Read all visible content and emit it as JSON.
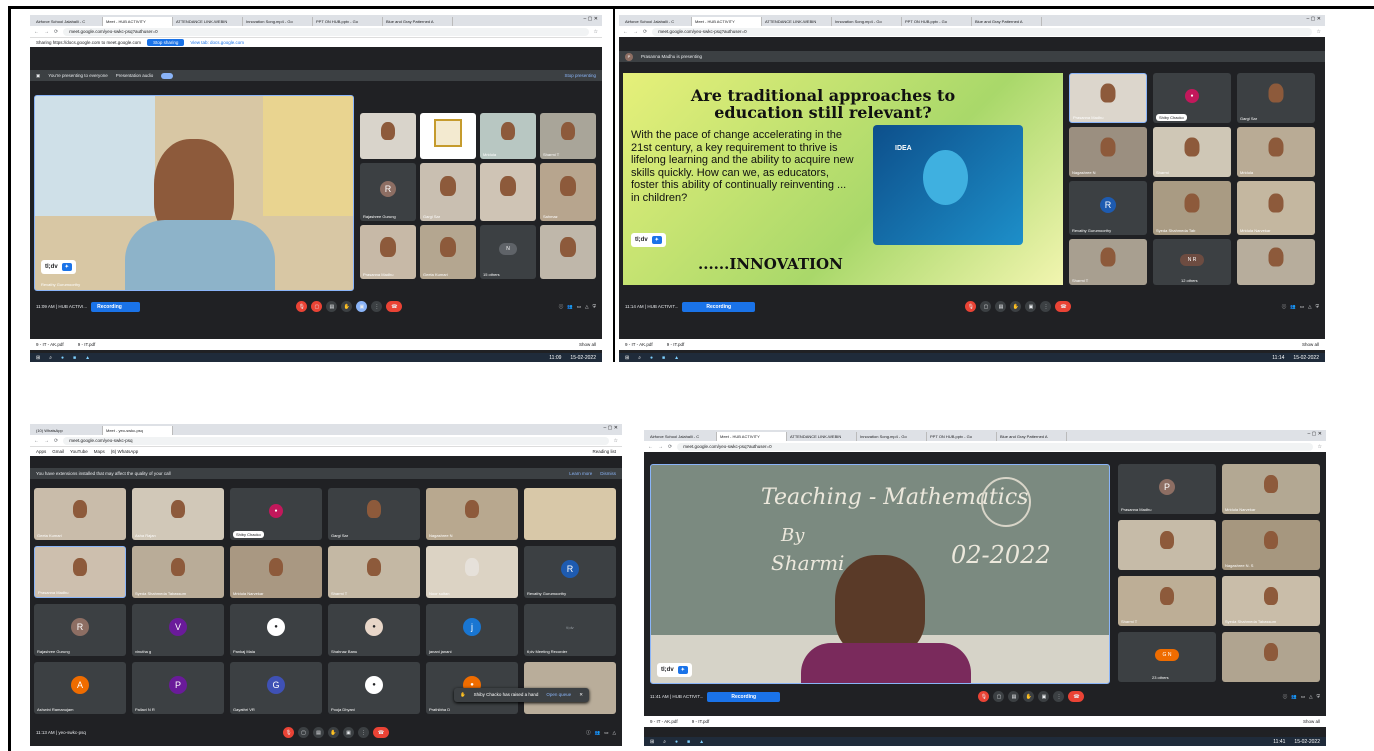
{
  "browser": {
    "tabs_a": [
      "Airforce School Jalahalli - C",
      "Meet - HUB ACTIVITY",
      "ATTENDANCE LINK-WEBIN",
      "Innovation Song.mp4 - Go",
      "PPT ON HUB.pptx - Go",
      "Blue and Gray Patterned A"
    ],
    "tabs_c": [
      "(10) WhatsApp",
      "Meet - yeo-swkc-psq"
    ],
    "url_a": "meet.google.com/yeo-swkc-psq?authuser=0",
    "url_c": "meet.google.com/yeo-swkc-psq",
    "bookmarks_c": [
      "Apps",
      "Gmail",
      "YouTube",
      "Maps",
      "(6) WhatsApp"
    ],
    "reading_list": "Reading list"
  },
  "panel1": {
    "sharing_text": "Sharing https://docs.google.com to meet.google.com",
    "stop_sharing": "Stop sharing",
    "view_tab": "View tab: docs.google.com",
    "presenting": "You're presenting to everyone",
    "presentation_audio": "Presentation audio",
    "stop_presenting": "Stop presenting",
    "main_name": "Revathy Gurumoorthy",
    "tiles": [
      "",
      "",
      "Mridula",
      "Sharmi T",
      "Rajashree Gurung",
      "Gargi Sar",
      "",
      "Sahmaz",
      "Prasanna Madhu",
      "Geeta Kumari",
      "15 others",
      ""
    ],
    "avatar_letter": "R",
    "time_meeting": "11:09 AM | HUB ACTIVI...",
    "recording": "Recording",
    "downloads": [
      "9 - IT - AK.pdf",
      "9 - IT.pdf"
    ],
    "show_all": "Show all",
    "clock_time": "11:09",
    "clock_date": "15-02-2022"
  },
  "panel2": {
    "presenting": "Prasanna Madhu is presenting",
    "slide_title": "Are traditional approaches to education still relevant?",
    "slide_body": "With the pace of change accelerating in the 21st century, a key requirement to thrive is lifelong learning and the ability to acquire new skills quickly. How can we, as educators, foster this ability of continually reinventing ... in children?",
    "slide_footer": "......INNOVATION",
    "tiles": [
      "Prasanna Madhu",
      "Shiby Chacko",
      "Gargi Sar",
      "Nagashree N",
      "Sharmi",
      "Mridula",
      "Revathy Gurumoorthy",
      "Syeda Shahmeda Tab",
      "Mridula Narvekar",
      "Sharmi T",
      "12 others",
      ""
    ],
    "avatar_letter": "R",
    "time_meeting": "11:14 AM | HUB ACTIVIT...",
    "recording": "Recording",
    "downloads": [
      "9 - IT - AK.pdf",
      "9 - IT.pdf"
    ],
    "show_all": "Show all",
    "clock_time": "11:14",
    "clock_date": "15-02-2022"
  },
  "panel3": {
    "ext_warning": "You have extensions installed that may affect the quality of your call",
    "learn_more": "Learn more",
    "dismiss": "Dismiss",
    "tiles": [
      "Geeta Kumari",
      "Asha Rajan",
      "Shiby Chacko",
      "Gargi Sar",
      "Nagashree N",
      "",
      "Prasanna Madhu",
      "Syeda Shahmeda Tabassum",
      "Mridula Narvekar",
      "Sharmi T",
      "Noor sultan",
      "Revathy Gurumoorthy",
      "Rajashree Gurung",
      "vinutha g",
      "Pankaj Mala",
      "Shahnaz Banu",
      "janani janani",
      "tl;dv Meeting Recorder",
      "Ashwini Ramanujam",
      "Pallavi N R",
      "Gayathri VR",
      "Pooja Dhyani",
      "Prathibha D",
      ""
    ],
    "letters": {
      "R1": "R",
      "V": "V",
      "J": "j",
      "A": "A",
      "P": "P",
      "G": "G",
      "R2": "R"
    },
    "toast": "Shiby Chacko has raised a hand",
    "open_queue": "Open queue",
    "time_meeting": "11:13 AM | yeo-swkc-psq"
  },
  "panel4": {
    "board_line1": "Teaching - Mathematics",
    "board_by": "By",
    "board_name": "Sharmi",
    "board_date": "02-2022",
    "tiles": [
      "Prasanna Madhu",
      "Mridula Narvekar",
      "",
      "Nagashree N. S",
      "Sharmi T",
      "Syeda Shahmeda Tabassum",
      "23 others",
      ""
    ],
    "avatar_p": "P",
    "others_letters": "G N",
    "time_meeting": "11:41 AM | HUB ACTIVIT...",
    "recording": "Recording",
    "downloads": [
      "9 - IT - AK.pdf",
      "9 - IT.pdf"
    ],
    "show_all": "Show all",
    "clock_time": "11:41",
    "clock_date": "15-02-2022"
  },
  "tldv": {
    "label": "tl;dv"
  },
  "colors": {
    "meet_bg": "#202124",
    "accent": "#1a73e8",
    "end_call": "#ea4335"
  }
}
